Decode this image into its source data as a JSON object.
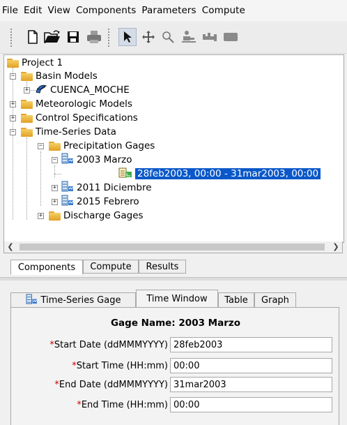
{
  "menu": [
    "File",
    "Edit",
    "View",
    "Components",
    "Parameters",
    "Compute"
  ],
  "toolbar": {
    "icons": [
      "new-file",
      "open-folder",
      "save-disk",
      "print",
      "select-arrow",
      "pan-move",
      "zoom",
      "add-subbasin",
      "add-reach",
      "add-junction"
    ],
    "active": "select-arrow"
  },
  "tree": {
    "project": "Project 1",
    "basin_models": "Basin Models",
    "basin": "CUENCA_MOCHE",
    "meteorologic": "Meteorologic Models",
    "control": "Control Specifications",
    "time_series": "Time-Series Data",
    "precip_gages": "Precipitation Gages",
    "gage_2003": "2003 Marzo",
    "window": "28feb2003, 00:00 - 31mar2003, 00:00",
    "gage_2011": "2011 Diciembre",
    "gage_2015": "2015 Febrero",
    "discharge": "Discharge Gages"
  },
  "colors": {
    "selection": "#0a58c9",
    "folder": "#e9b23a",
    "required": "#d00000"
  },
  "nav_tabs": [
    "Components",
    "Compute",
    "Results"
  ],
  "editor_tabs": [
    "Time-Series Gage",
    "Time Window",
    "Table",
    "Graph"
  ],
  "form": {
    "gage_name_label": "Gage Name: 2003 Marzo",
    "req": "*",
    "start_date_label": "Start Date (ddMMMYYYY)",
    "start_date": "28feb2003",
    "start_time_label": "Start Time (HH:mm)",
    "start_time": "00:00",
    "end_date_label": "End Date (ddMMMYYYY)",
    "end_date": "31mar2003",
    "end_time_label": "End Time (HH:mm)",
    "end_time": "00:00"
  }
}
